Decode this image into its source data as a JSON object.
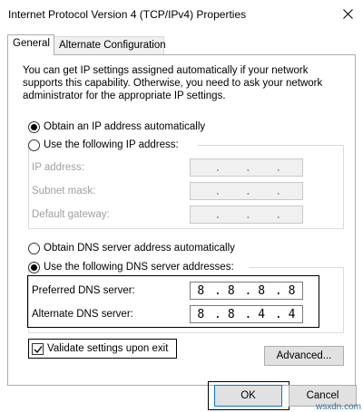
{
  "window": {
    "title": "Internet Protocol Version 4 (TCP/IPv4) Properties"
  },
  "tabs": [
    {
      "label": "General",
      "selected": true
    },
    {
      "label": "Alternate Configuration",
      "selected": false
    }
  ],
  "intro_text": "You can get IP settings assigned automatically if your network supports this capability. Otherwise, you need to ask your network administrator for the appropriate IP settings.",
  "ip_section": {
    "auto_label": "Obtain an IP address automatically",
    "auto_selected": true,
    "manual_label": "Use the following IP address:",
    "manual_selected": false,
    "fields": [
      {
        "label": "IP address:",
        "octets": [
          "",
          "",
          "",
          ""
        ],
        "disabled": true
      },
      {
        "label": "Subnet mask:",
        "octets": [
          "",
          "",
          "",
          ""
        ],
        "disabled": true
      },
      {
        "label": "Default gateway:",
        "octets": [
          "",
          "",
          "",
          ""
        ],
        "disabled": true
      }
    ]
  },
  "dns_section": {
    "auto_label": "Obtain DNS server address automatically",
    "auto_selected": false,
    "manual_label": "Use the following DNS server addresses:",
    "manual_selected": true,
    "fields": [
      {
        "label": "Preferred DNS server:",
        "octets": [
          "8",
          "8",
          "8",
          "8"
        ],
        "disabled": false
      },
      {
        "label": "Alternate DNS server:",
        "octets": [
          "8",
          "8",
          "4",
          "4"
        ],
        "disabled": false
      }
    ]
  },
  "validate": {
    "label": "Validate settings upon exit",
    "checked": true
  },
  "buttons": {
    "advanced": "Advanced...",
    "ok": "OK",
    "cancel": "Cancel"
  },
  "watermark": "wsxdn.com"
}
